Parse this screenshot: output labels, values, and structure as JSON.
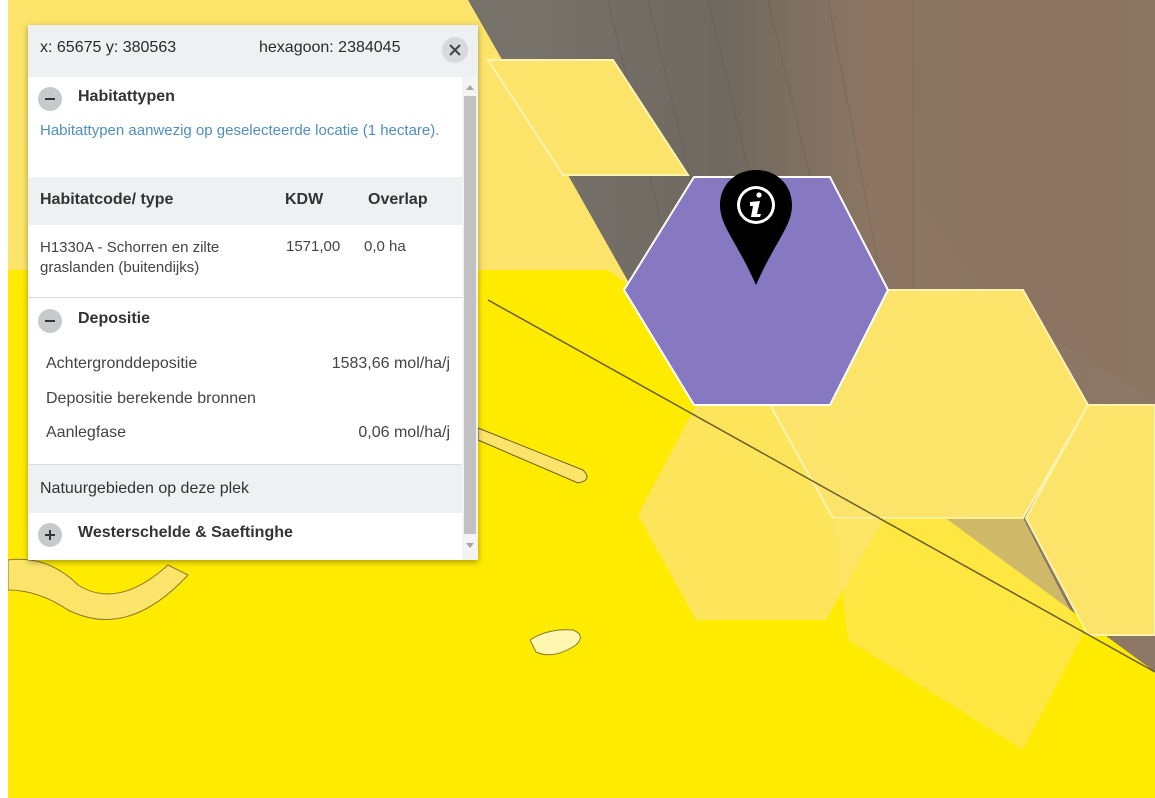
{
  "popup": {
    "coordinates": "x: 65675 y: 380563",
    "hexagon": "hexagoon: 2384045",
    "close_label": "×",
    "habitat": {
      "title": "Habitattypen",
      "intro": "Habitattypen aanwezig op geselecteerde locatie (1 hectare).",
      "columns": [
        "Habitatcode/ type",
        "KDW",
        "Overlap"
      ],
      "rows": [
        {
          "type": "H1330A - Schorren en zilte graslanden (buitendijks)",
          "kdw": "1571,00",
          "overlap": "0,0 ha"
        }
      ]
    },
    "deposition": {
      "title": "Depositie",
      "rows": [
        {
          "label": "Achtergronddepositie",
          "value": "1583,66 mol/ha/j"
        },
        {
          "label": "Depositie berekende bronnen",
          "value": ""
        },
        {
          "label": "Aanlegfase",
          "value": "0,06 mol/ha/j"
        }
      ]
    },
    "nature_areas": {
      "heading": "Natuurgebieden op deze plek",
      "items": [
        {
          "label": "Westerschelde & Saeftinghe"
        }
      ]
    }
  },
  "map": {
    "marker_icon": "info-icon",
    "colors": {
      "water": "#ffeb00",
      "hexagon_fill": "#fce46a",
      "selected_hexagon": "#8679c2",
      "aerial_dark": "#6d6a62",
      "aerial_brown": "#8a735f",
      "marker": "#000000"
    }
  }
}
